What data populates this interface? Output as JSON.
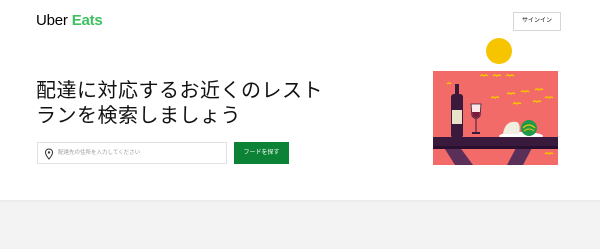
{
  "brand": {
    "uber": "Uber",
    "eats": "Eats"
  },
  "header": {
    "signin_label": "サインイン"
  },
  "hero": {
    "headline": "配達に対応するお近くのレストランを検索しましょう",
    "address_placeholder": "配達先の住所を入力してください",
    "find_button_label": "フードを探す"
  },
  "colors": {
    "brand_green": "#3fc060",
    "button_green": "#0b8235",
    "illustration_bg": "#f26b68",
    "sun": "#f7c500"
  },
  "icons": {
    "address": "map-pin-icon"
  }
}
